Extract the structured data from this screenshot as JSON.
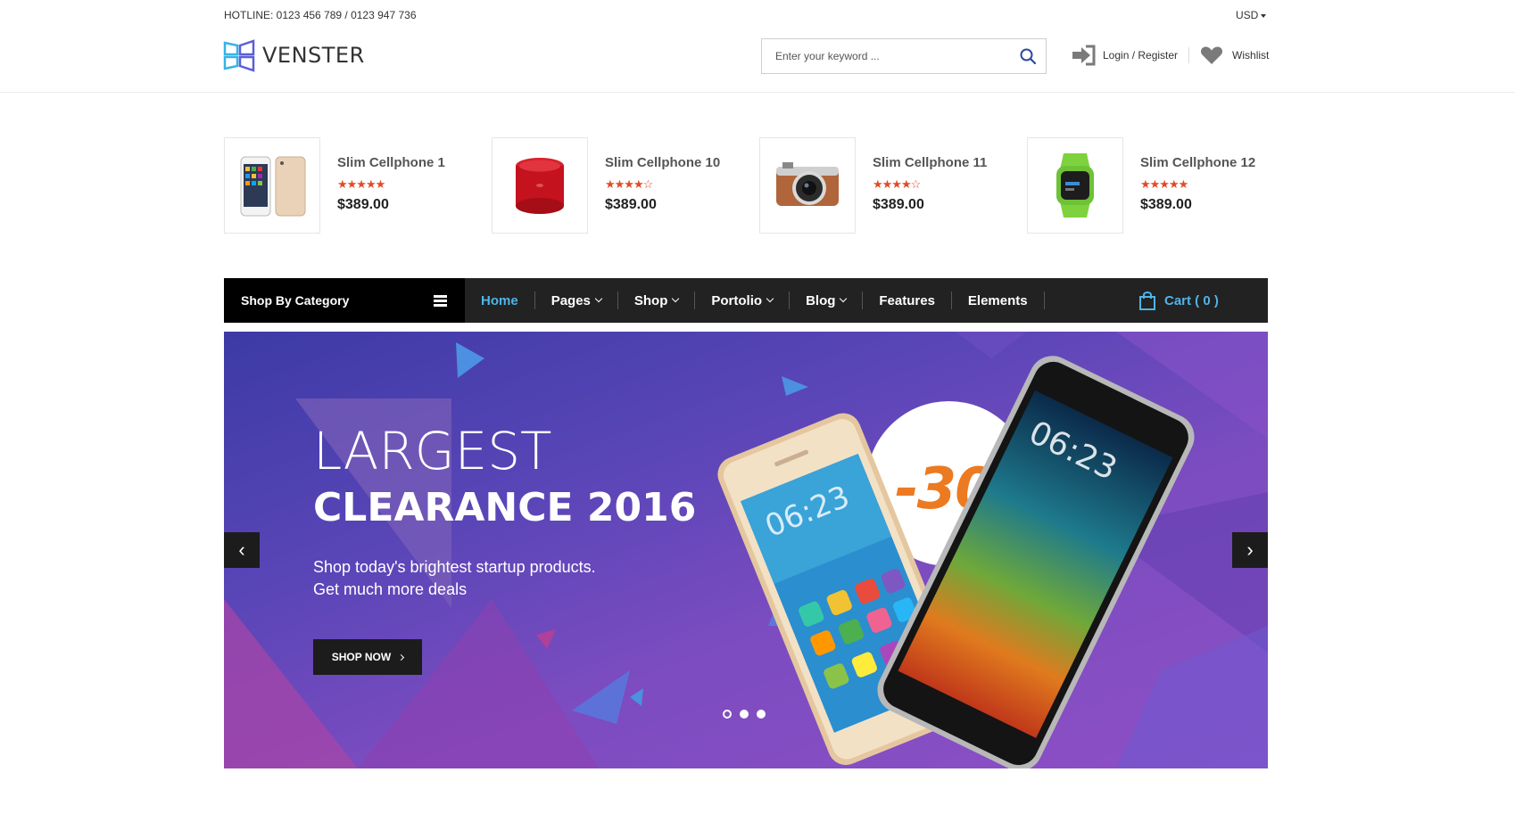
{
  "header": {
    "hotline": "HOTLINE: 0123 456 789 / 0123 947 736",
    "currency": "USD",
    "logo_text": "VENSTER",
    "search_placeholder": "Enter your keyword ...",
    "login_label": "Login / Register",
    "wishlist_label": "Wishlist"
  },
  "products": [
    {
      "name": "Slim Cellphone 1",
      "rating": 5,
      "stars_text_on": "★★★★★",
      "stars_text_off": "",
      "price": "$389.00",
      "image": "phones"
    },
    {
      "name": "Slim Cellphone 10",
      "rating": 4,
      "stars_text_on": "★★★★",
      "stars_text_off": "☆",
      "price": "$389.00",
      "image": "speaker"
    },
    {
      "name": "Slim Cellphone 11",
      "rating": 4,
      "stars_text_on": "★★★★",
      "stars_text_off": "☆",
      "price": "$389.00",
      "image": "camera"
    },
    {
      "name": "Slim Cellphone 12",
      "rating": 5,
      "stars_text_on": "★★★★★",
      "stars_text_off": "",
      "price": "$389.00",
      "image": "smartwatch"
    }
  ],
  "nav": {
    "category_label": "Shop By Category",
    "items": [
      {
        "label": "Home",
        "active": true,
        "dropdown": false
      },
      {
        "label": "Pages",
        "active": false,
        "dropdown": true
      },
      {
        "label": "Shop",
        "active": false,
        "dropdown": true
      },
      {
        "label": "Portolio",
        "active": false,
        "dropdown": true
      },
      {
        "label": "Blog",
        "active": false,
        "dropdown": true
      },
      {
        "label": "Features",
        "active": false,
        "dropdown": false
      },
      {
        "label": "Elements",
        "active": false,
        "dropdown": false
      }
    ],
    "cart_label": "Cart ( 0 )"
  },
  "hero": {
    "headline": "LARGEST",
    "subheadline": "CLEARANCE 2016",
    "line1": "Shop today's brightest startup products.",
    "line2": "Get much more deals",
    "cta_label": "SHOP NOW",
    "badge": "-30%",
    "prev_arrow": "‹",
    "next_arrow": "›",
    "slide_count": 3,
    "active_slide": 0
  },
  "colors": {
    "accent": "#4fb4e8",
    "star": "#e24a27",
    "badge": "#ec7a21",
    "nav_bg": "#222222"
  }
}
